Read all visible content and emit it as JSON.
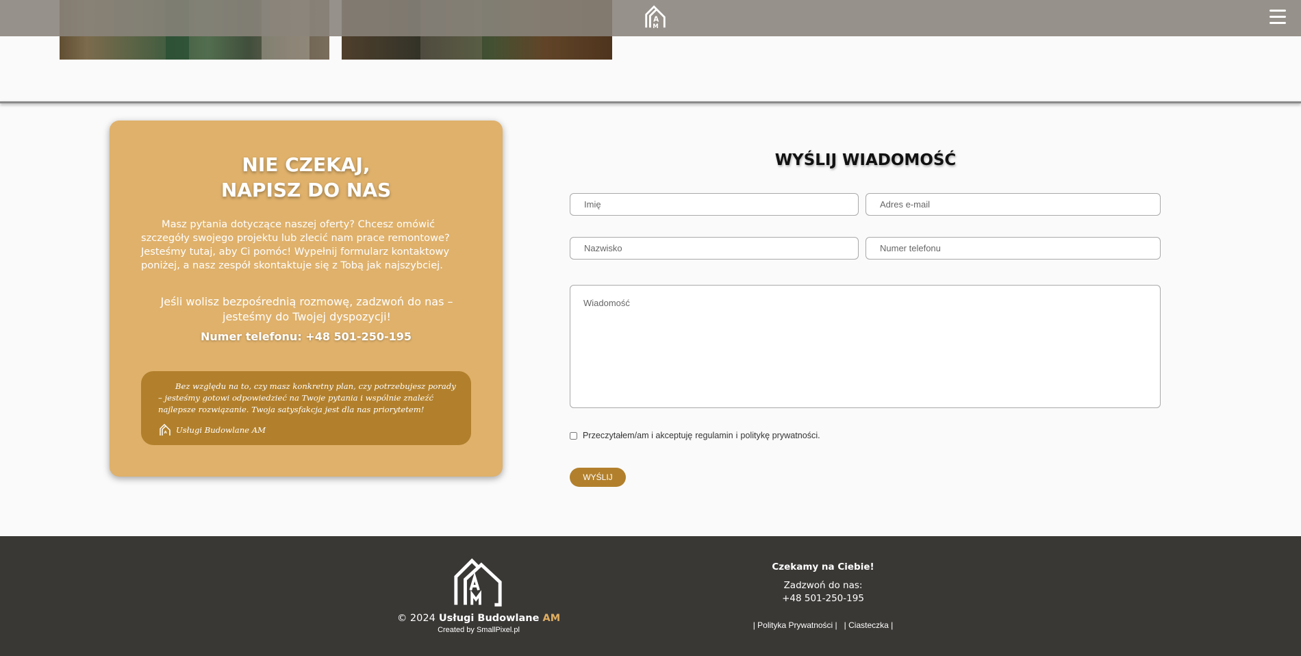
{
  "header": {
    "logo_icon": "am-house-logo-icon",
    "menu_icon": "hamburger-menu-icon"
  },
  "gallery": {
    "images": [
      "construction-photo",
      "construction-photo"
    ]
  },
  "contact_card": {
    "title_line1": "NIE CZEKAJ,",
    "title_line2": "NAPISZ DO NAS",
    "intro": "Masz pytania dotyczące naszej oferty? Chcesz omówić szczegóły swojego projektu lub zlecić nam prace remontowe? Jesteśmy tutaj, aby Ci pomóc! Wypełnij formularz kontaktowy poniżej, a nasz zespół skontaktuje się z Tobą jak najszybciej.",
    "call_text": "Jeśli wolisz bezpośrednią rozmowę, zadzwoń do nas – jesteśmy do Twojej dyspozycji!",
    "phone_text": "Numer telefonu: +48 501-250-195",
    "quote_text": "Bez względu na to, czy masz konkretny plan, czy potrzebujesz porady – jesteśmy gotowi odpowiedzieć na Twoje pytania i wspólnie znaleźć najlepsze rozwiązanie. Twoja satysfakcja jest dla nas priorytetem!",
    "quote_signature": "Usługi Budowlane AM",
    "accent_color": "#dfb16b",
    "quote_color": "#b2802c"
  },
  "form": {
    "title": "WYŚLIJ WIADOMOŚĆ",
    "first_name_placeholder": "Imię",
    "email_placeholder": "Adres e-mail",
    "last_name_placeholder": "Nazwisko",
    "phone_placeholder": "Numer telefonu",
    "message_placeholder": "Wiadomość",
    "consent_prefix": "Przeczytałem/am i akceptuję",
    "consent_regulamin": "regulamin",
    "consent_and": "i",
    "consent_privacy": "politykę prywatności.",
    "submit_label": "WYŚLIJ",
    "button_color": "#b2802c"
  },
  "footer": {
    "copyright_year": "© 2024",
    "brand_name": "Usługi Budowlane",
    "brand_suffix": "AM",
    "credit_prefix": "Created by",
    "credit_link": "SmallPixel.pl",
    "heading": "Czekamy na Ciebie!",
    "call_label": "Zadzwoń do nas:",
    "phone": "+48 501-250-195",
    "link_privacy": "Polityka Prywatności",
    "link_cookies": "Ciasteczka",
    "background_color": "#3a3835",
    "brand_accent": "#e0ae61"
  }
}
